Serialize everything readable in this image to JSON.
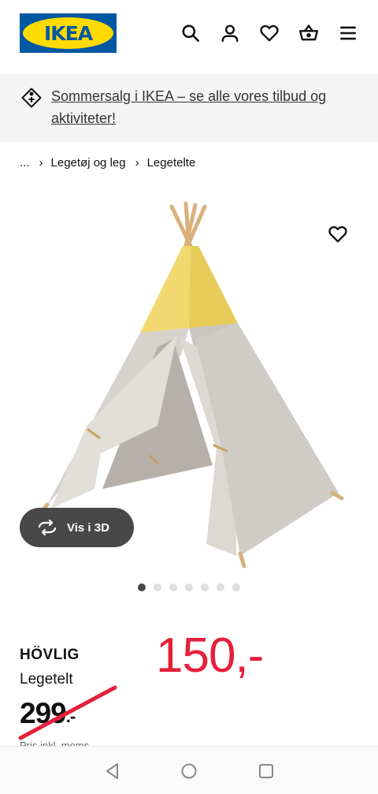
{
  "header": {
    "logo_text": "IKEA",
    "icons": [
      "search-icon",
      "user-icon",
      "heart-icon",
      "basket-icon",
      "menu-icon"
    ]
  },
  "promo": {
    "icon": "price-tag-icon",
    "text": "Sommersalg i IKEA – se alle vores tilbud og aktiviteter!"
  },
  "breadcrumb": {
    "ellipsis": "...",
    "items": [
      "Legetøj og leg",
      "Legetelte"
    ]
  },
  "gallery": {
    "view_3d_label": "Vis i 3D",
    "dot_count": 7,
    "active_dot": 0
  },
  "product": {
    "name": "HÖVLIG",
    "type": "Legetelt",
    "new_price": "150,-",
    "old_price": "299",
    "old_price_suffix": ".-",
    "price_note": "Pris inkl. moms"
  },
  "colors": {
    "brand_blue": "#0058a3",
    "brand_yellow": "#ffdb00",
    "sale_red": "#e5203a"
  }
}
